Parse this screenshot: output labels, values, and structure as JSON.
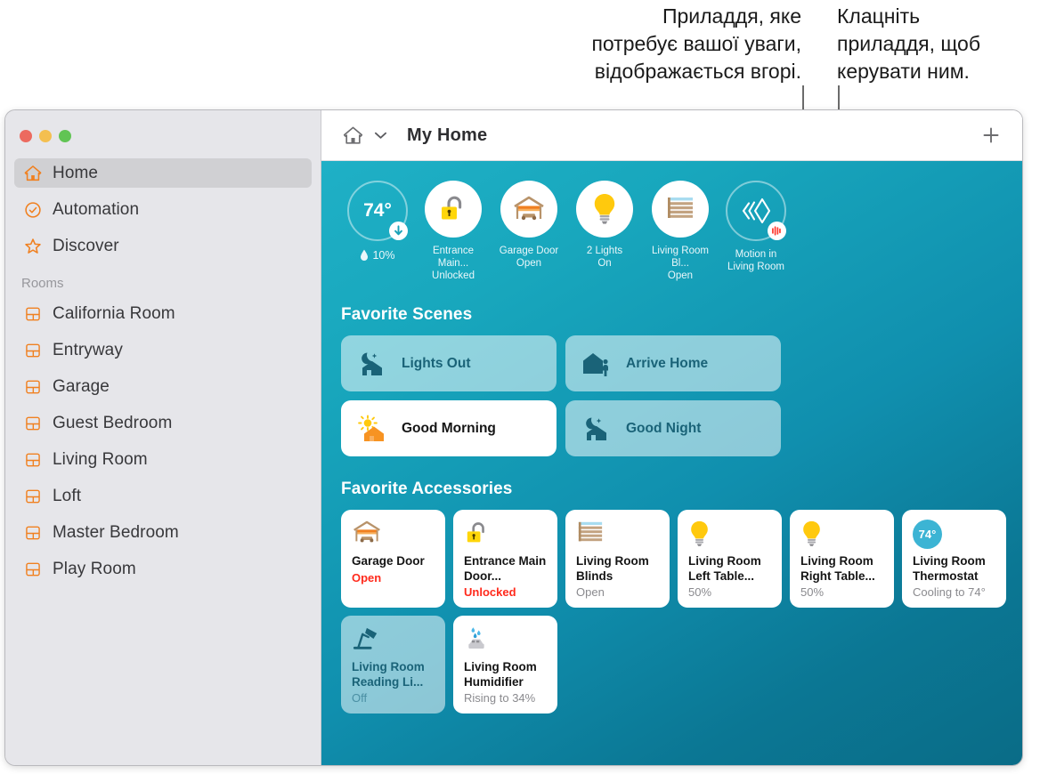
{
  "annotations": [
    {
      "id": "top-accessories-note",
      "text": "Приладдя, яке\nпотребує вашої уваги,\nвідображається вгорі."
    },
    {
      "id": "click-accessory-note",
      "text": "Клацніть\nприладдя, щоб\nкерувати ним."
    }
  ],
  "window": {
    "traffic_lights": [
      "close-button",
      "minimize-button",
      "zoom-button"
    ]
  },
  "toolbar": {
    "home_icon": "home-icon",
    "chevron": "chevron-down-icon",
    "title": "My Home",
    "add_label": "+"
  },
  "sidebar": {
    "nav": [
      {
        "label": "Home",
        "icon": "home-icon",
        "selected": true
      },
      {
        "label": "Automation",
        "icon": "clock-check-icon",
        "selected": false
      },
      {
        "label": "Discover",
        "icon": "star-icon",
        "selected": false
      }
    ],
    "rooms_header": "Rooms",
    "rooms": [
      {
        "label": "California Room",
        "icon": "room-icon"
      },
      {
        "label": "Entryway",
        "icon": "room-icon"
      },
      {
        "label": "Garage",
        "icon": "room-icon"
      },
      {
        "label": "Guest Bedroom",
        "icon": "room-icon"
      },
      {
        "label": "Living Room",
        "icon": "room-icon"
      },
      {
        "label": "Loft",
        "icon": "room-icon"
      },
      {
        "label": "Master Bedroom",
        "icon": "room-icon"
      },
      {
        "label": "Play Room",
        "icon": "room-icon"
      }
    ]
  },
  "status": {
    "temperature": "74°",
    "humidity": "10%",
    "items": [
      {
        "icon": "thermostat-ring-icon",
        "line1": "",
        "line2": ""
      },
      {
        "icon": "unlocked-padlock-icon",
        "line1": "Entrance Main...",
        "line2": "Unlocked"
      },
      {
        "icon": "garage-door-icon",
        "line1": "Garage Door",
        "line2": "Open"
      },
      {
        "icon": "lightbulb-icon",
        "line1": "2 Lights",
        "line2": "On"
      },
      {
        "icon": "blinds-icon",
        "line1": "Living Room Bl...",
        "line2": "Open"
      },
      {
        "icon": "motion-sensor-icon",
        "line1": "Motion in",
        "line2": "Living Room"
      }
    ]
  },
  "scenes": {
    "title": "Favorite Scenes",
    "items": [
      {
        "label": "Lights Out",
        "icon": "moon-house-icon",
        "active": false
      },
      {
        "label": "Arrive Home",
        "icon": "house-person-icon",
        "active": false
      },
      {
        "label": "Good Morning",
        "icon": "sun-house-icon",
        "active": true
      },
      {
        "label": "Good Night",
        "icon": "moon-house-icon",
        "active": false
      }
    ]
  },
  "accessories": {
    "title": "Favorite Accessories",
    "items": [
      {
        "name": "Garage Door",
        "state": "Open",
        "icon": "garage-door-icon",
        "alert": true,
        "off": false
      },
      {
        "name": "Entrance Main Door...",
        "state": "Unlocked",
        "icon": "unlocked-padlock-icon",
        "alert": true,
        "off": false
      },
      {
        "name": "Living Room Blinds",
        "state": "Open",
        "icon": "blinds-icon",
        "alert": false,
        "off": false
      },
      {
        "name": "Living Room Left Table...",
        "state": "50%",
        "icon": "lightbulb-icon",
        "alert": false,
        "off": false
      },
      {
        "name": "Living Room Right Table...",
        "state": "50%",
        "icon": "lightbulb-icon",
        "alert": false,
        "off": false
      },
      {
        "name": "Living Room Thermostat",
        "state": "Cooling to 74°",
        "icon": "thermostat-pill-icon",
        "alert": false,
        "off": false,
        "pill": "74°"
      },
      {
        "name": "Living Room Reading Li...",
        "state": "Off",
        "icon": "desk-lamp-icon",
        "alert": false,
        "off": true
      },
      {
        "name": "Living Room Humidifier",
        "state": "Rising to 34%",
        "icon": "humidifier-icon",
        "alert": false,
        "off": false
      }
    ]
  },
  "colors": {
    "accent_orange": "#f08020",
    "alert_red": "#ff2a1c",
    "teal_bg": "#13a0b8",
    "scene_blue": "#1a6378",
    "bulb_yellow": "#ffc90d"
  }
}
